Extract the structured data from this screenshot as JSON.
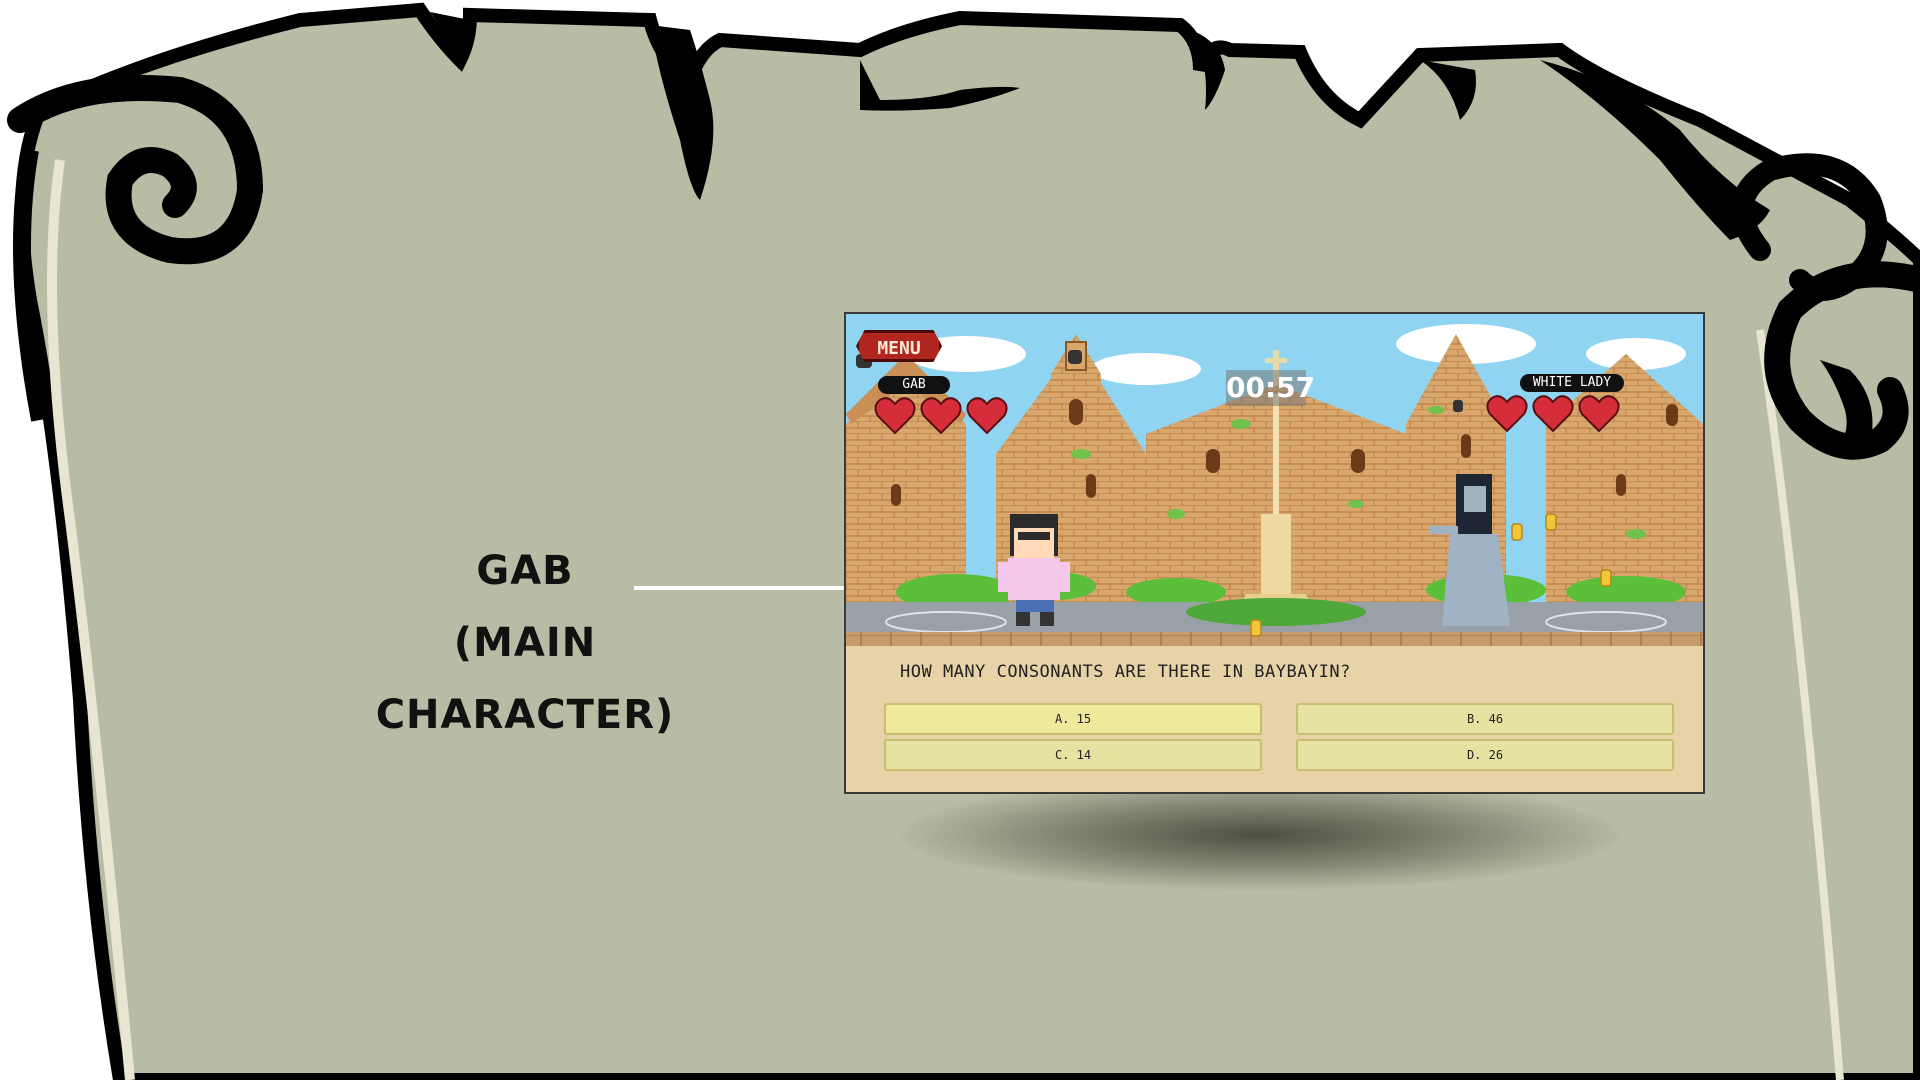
{
  "callout": {
    "line1": "GAB",
    "line2": "(MAIN CHARACTER)"
  },
  "game": {
    "menu_label": "MENU",
    "player": {
      "name": "GAB",
      "hearts": 3
    },
    "enemy": {
      "name": "WHITE LADY",
      "hearts": 3
    },
    "timer": "00:57",
    "question": "HOW MANY CONSONANTS ARE THERE IN BAYBAYIN?",
    "answers": [
      {
        "label": "A. 15"
      },
      {
        "label": "B. 46"
      },
      {
        "label": "C. 14"
      },
      {
        "label": "D. 26"
      }
    ]
  },
  "colors": {
    "scroll_fill": "#b9bca4",
    "scroll_outline": "#000000",
    "heart": "#d62d3a",
    "menu": "#b0261e",
    "answer_fill": "#e6e3a2",
    "panel": "#e8d3a8",
    "brick": "#d9a66c"
  },
  "icons": [
    "heart-icon",
    "bell-icon",
    "cross-icon",
    "coin-icon",
    "arrow-icon"
  ]
}
